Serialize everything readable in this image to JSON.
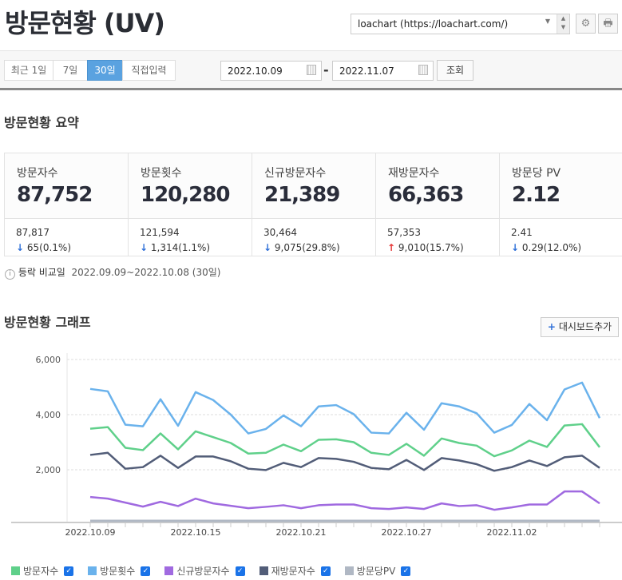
{
  "header": {
    "title": "방문현황 (UV)",
    "site_select": "loachart (https://loachart.com/)",
    "settings_icon": "gear-icon",
    "print_icon": "print-icon"
  },
  "period": {
    "options": [
      "최근 1일",
      "7일",
      "30일",
      "직접입력"
    ],
    "selected": "30일",
    "start": "2022.10.09",
    "end": "2022.11.07",
    "separator": "-",
    "search": "조회"
  },
  "summary": {
    "title": "방문현황 요약",
    "cards": [
      {
        "label": "방문자수",
        "value": "87,752",
        "prev": "87,817",
        "dir": "down",
        "change": "65(0.1%)"
      },
      {
        "label": "방문횟수",
        "value": "120,280",
        "prev": "121,594",
        "dir": "down",
        "change": "1,314(1.1%)"
      },
      {
        "label": "신규방문자수",
        "value": "21,389",
        "prev": "30,464",
        "dir": "down",
        "change": "9,075(29.8%)"
      },
      {
        "label": "재방문자수",
        "value": "66,363",
        "prev": "57,353",
        "dir": "up",
        "change": "9,010(15.7%)"
      },
      {
        "label": "방문당 PV",
        "value": "2.12",
        "prev": "2.41",
        "dir": "down",
        "change": "0.29(12.0%)"
      }
    ],
    "compare_label": "등락 비교일",
    "compare_range": "2022.09.09~2022.10.08 (30일)"
  },
  "graph": {
    "title": "방문현황 그래프",
    "add_button": "대시보드추가"
  },
  "chart_data": {
    "type": "line",
    "ylim": [
      0,
      6000
    ],
    "yticks": [
      "6,000",
      "4,000",
      "2,000"
    ],
    "ytick_values": [
      6000,
      4000,
      2000
    ],
    "xtick_labels": [
      "2022.10.09",
      "2022.10.15",
      "2022.10.21",
      "2022.10.27",
      "2022.11.02"
    ],
    "xtick_index": [
      0,
      6,
      12,
      18,
      24
    ],
    "x_start": "2022.10.09",
    "x_end": "2022.11.07",
    "grid": true,
    "legend_placement": "bottom",
    "series": [
      {
        "name": "방문횟수",
        "color": "#6ab2ec",
        "checked": true,
        "values": [
          4933,
          4846,
          3635,
          3577,
          4558,
          3596,
          4817,
          4529,
          4000,
          3317,
          3481,
          3971,
          3577,
          4298,
          4346,
          4019,
          3346,
          3317,
          4067,
          3452,
          4413,
          4298,
          4048,
          3346,
          3625,
          4385,
          3798,
          4913,
          5163,
          3875
        ]
      },
      {
        "name": "방문자수",
        "color": "#5fd08a",
        "checked": true,
        "values": [
          3490,
          3548,
          2798,
          2712,
          3317,
          2740,
          3394,
          3183,
          2971,
          2587,
          2615,
          2913,
          2673,
          3087,
          3106,
          3000,
          2615,
          2538,
          2942,
          2510,
          3135,
          2971,
          2875,
          2490,
          2702,
          3058,
          2827,
          3606,
          3654,
          2817
        ]
      },
      {
        "name": "재방문자수",
        "color": "#525d78",
        "checked": true,
        "values": [
          2538,
          2615,
          2038,
          2096,
          2510,
          2067,
          2481,
          2481,
          2308,
          2038,
          1990,
          2250,
          2096,
          2423,
          2394,
          2288,
          2067,
          2019,
          2356,
          1990,
          2423,
          2336,
          2202,
          1962,
          2096,
          2336,
          2135,
          2452,
          2510,
          2067
        ]
      },
      {
        "name": "신규방문자수",
        "color": "#a06ae0",
        "checked": true,
        "values": [
          1010,
          952,
          808,
          663,
          837,
          683,
          952,
          779,
          692,
          606,
          654,
          712,
          606,
          712,
          740,
          740,
          606,
          577,
          635,
          577,
          779,
          683,
          712,
          548,
          635,
          740,
          740,
          1212,
          1212,
          779
        ]
      },
      {
        "name": "방문당PV",
        "color": "#b0b8c4",
        "checked": true,
        "values": [
          2.3,
          2.4,
          2.1,
          2.1,
          2.2,
          2.1,
          2.2,
          2.1,
          2.1,
          2.0,
          2.0,
          2.1,
          2.1,
          2.1,
          2.1,
          2.1,
          2.1,
          2.1,
          2.1,
          2.1,
          2.1,
          2.1,
          2.1,
          2.1,
          2.1,
          2.1,
          2.1,
          2.1,
          2.1,
          2.1
        ]
      }
    ],
    "legend_order": [
      "방문자수",
      "방문횟수",
      "신규방문자수",
      "재방문자수",
      "방문당PV"
    ]
  }
}
